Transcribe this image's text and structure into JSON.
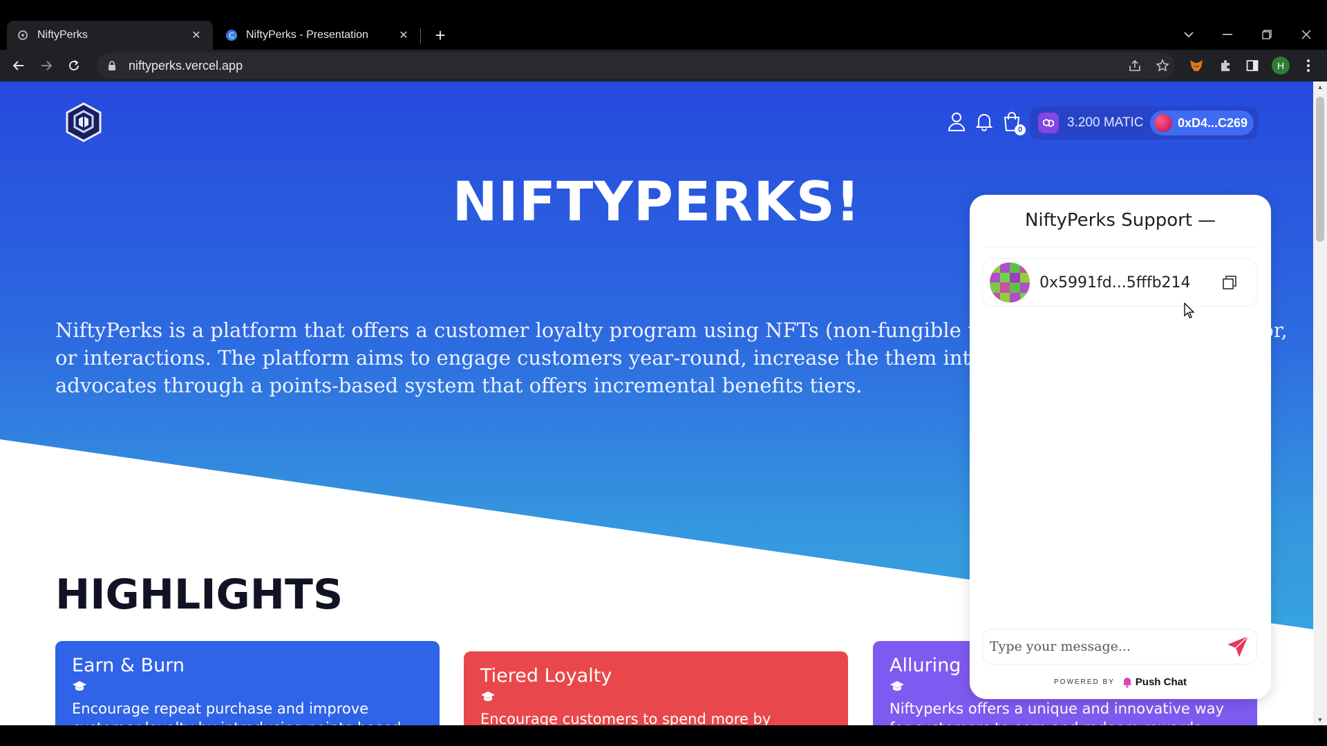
{
  "browser": {
    "tabs": [
      {
        "title": "NiftyPerks",
        "active": true
      },
      {
        "title": "NiftyPerks - Presentation",
        "active": false
      }
    ],
    "url": "niftyperks.vercel.app",
    "profile_initial": "H"
  },
  "header": {
    "cart_count": "0",
    "balance": "3.200 MATIC",
    "address": "0xD4...C269"
  },
  "hero": {
    "title": "NIFTYPERKS!",
    "description": "NiftyPerks is a platform that offers a customer loyalty program using NFTs (non-fungible tokens) as purchases, behavior, or interactions. The platform aims to engage customers year-round, increase the them into loyal customers and advocates through a points-based system that offers incremental benefits tiers."
  },
  "highlights": {
    "title": "HIGHLIGHTS",
    "cards": [
      {
        "title": "Earn & Burn",
        "text": "Encourage repeat purchase and improve customer loyalty by introducing points-based"
      },
      {
        "title": "Tiered Loyalty",
        "text": "Encourage customers to spend more by enticing"
      },
      {
        "title": "Alluring",
        "text": "Niftyperks offers a unique and innovative way for customers to earn and redeem rewards through"
      }
    ]
  },
  "chat": {
    "title": "NiftyPerks Support",
    "minimize": "—",
    "peer_address": "0x5991fd...5fffb214",
    "placeholder": "Type your message...",
    "powered_by": "POWERED BY",
    "brand": "Push Chat"
  },
  "colors": {
    "hero_top": "#2649dd",
    "hero_bottom": "#37aee0",
    "card_blue": "#2f63e8",
    "card_red": "#e8484c",
    "card_purple": "#7f5af0",
    "send_icon": "#e8365d"
  }
}
